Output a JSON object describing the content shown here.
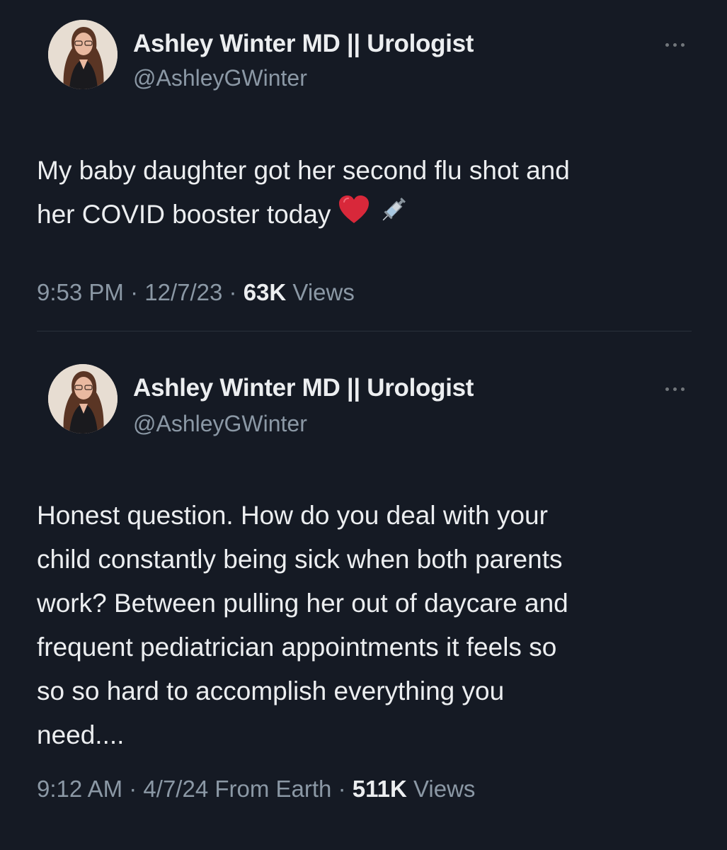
{
  "tweets": [
    {
      "author_name": "Ashley Winter MD || Urologist",
      "handle": "@AshleyGWinter",
      "text": "My baby daughter got her second flu shot and\nher COVID booster today",
      "emojis": [
        "heart-emoji",
        "syringe-emoji"
      ],
      "time": "9:53 PM",
      "date": "12/7/23",
      "source": "",
      "view_count": "63K",
      "views_label": "Views"
    },
    {
      "author_name": "Ashley Winter MD || Urologist",
      "handle": "@AshleyGWinter",
      "text": "Honest question. How do you deal with your\nchild constantly being sick when both parents\nwork? Between pulling her out of daycare and\nfrequent pediatrician appointments it feels so\nso so hard to accomplish everything you\nneed....",
      "time": "9:12 AM",
      "date": "4/7/24",
      "source": "From Earth",
      "view_count": "511K",
      "views_label": "Views"
    }
  ],
  "colors": {
    "background": "#151a24",
    "primary_text": "#eceef0",
    "secondary_text": "#8b98a5",
    "divider": "#2a313b",
    "heart": "#d8283a"
  }
}
